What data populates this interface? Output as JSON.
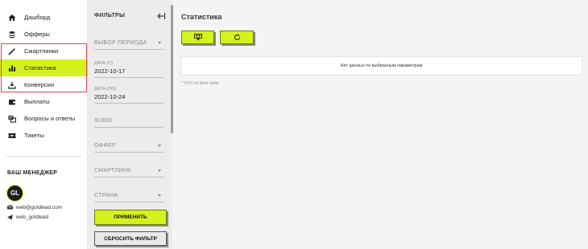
{
  "sidebar": {
    "items": [
      {
        "label": "Дашборд",
        "icon": "home-icon"
      },
      {
        "label": "Офферы",
        "icon": "layers-icon"
      },
      {
        "label": "Смартлинки",
        "icon": "magic-wand-icon"
      },
      {
        "label": "Статистика",
        "icon": "bar-chart-icon",
        "active": true
      },
      {
        "label": "Конверсии",
        "icon": "conversion-icon"
      },
      {
        "label": "Выплаты",
        "icon": "wallet-icon"
      },
      {
        "label": "Вопросы и ответы",
        "icon": "faq-icon"
      },
      {
        "label": "Тикеты",
        "icon": "ticket-icon"
      }
    ],
    "manager": {
      "title": "ВАШ МЕНЕДЖЕР",
      "avatar_text": "GL",
      "email": "web@goldlead.com",
      "telegram": "web_goldlead"
    }
  },
  "filters": {
    "title": "ФИЛЬТРЫ",
    "period_placeholder": "ВЫБОР ПЕРИОДА",
    "date_from_label": "ДАТА (С)",
    "date_from_value": "2022-10-17",
    "date_to_label": "ДАТА (ПО)",
    "date_to_value": "2022-10-24",
    "subid_placeholder": "SUBID",
    "offer_placeholder": "ОФФЕР",
    "smartlink_placeholder": "СМАРТЛИНК",
    "country_placeholder": "СТРАНА",
    "apply_label": "ПРИМЕНИТЬ",
    "reset_label": "СБРОСИТЬ ФИЛЬТР"
  },
  "main": {
    "title": "Статистика",
    "empty_text": "Нет данных по выбранным параметрам",
    "tz_note": "* UTC+0 time zone"
  },
  "colors": {
    "accent": "#d4f21b",
    "highlight_border": "#e2434a"
  }
}
